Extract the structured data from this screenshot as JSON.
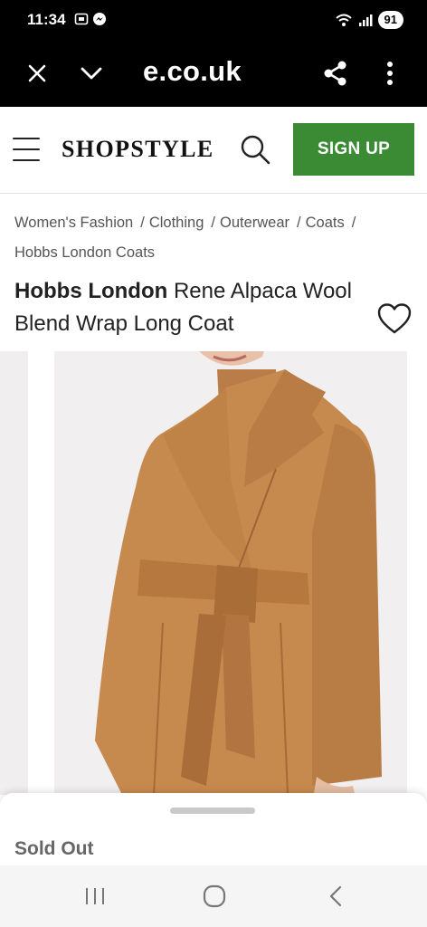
{
  "status_bar": {
    "time": "11:34",
    "battery": "91"
  },
  "browser": {
    "url": "e.co.uk"
  },
  "header": {
    "logo": "SHOPSTYLE",
    "signup_label": "SIGN UP"
  },
  "breadcrumb": {
    "items": [
      "Women's Fashion",
      "Clothing",
      "Outerwear",
      "Coats"
    ],
    "current": "Hobbs London Coats",
    "separator": "/"
  },
  "product": {
    "brand": "Hobbs London",
    "name": "Rene Alpaca Wool Blend Wrap Long Coat",
    "coat_color": "#c68a4e"
  },
  "sheet": {
    "status": "Sold Out"
  },
  "colors": {
    "accent": "#3a8b34",
    "browser_bg": "#000000"
  }
}
